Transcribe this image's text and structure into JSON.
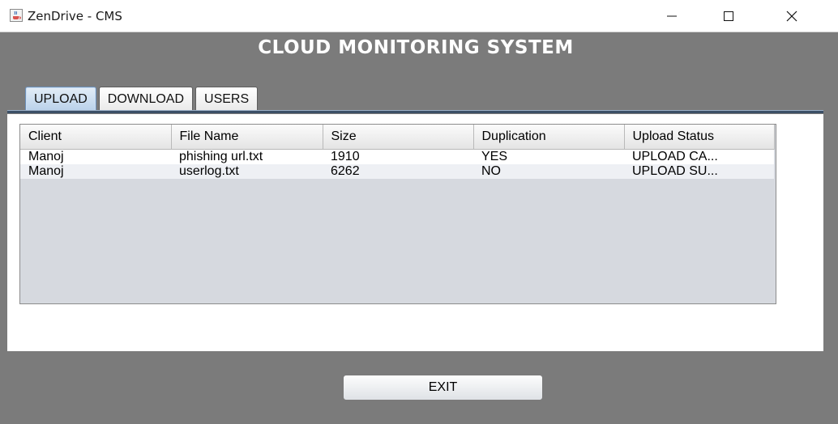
{
  "window": {
    "title": "ZenDrive - CMS",
    "minimize_glyph": "—",
    "maximize_glyph": "☐",
    "close_glyph": "✕"
  },
  "heading": "CLOUD MONITORING SYSTEM",
  "tabs": [
    {
      "label": "UPLOAD",
      "active": true
    },
    {
      "label": "DOWNLOAD",
      "active": false
    },
    {
      "label": "USERS",
      "active": false
    }
  ],
  "table": {
    "columns": [
      "Client",
      "File Name",
      "Size",
      "Duplication",
      "Upload Status"
    ],
    "rows": [
      [
        "Manoj",
        "phishing url.txt",
        "1910",
        "YES",
        "UPLOAD CA..."
      ],
      [
        "Manoj",
        "userlog.txt",
        "6262",
        "NO",
        "UPLOAD SU..."
      ]
    ]
  },
  "exit_label": "EXIT",
  "colors": {
    "background": "#7b7b7b",
    "active_tab": "#b9d1ea",
    "heading_text": "#ffffff"
  },
  "icons": {
    "app": "java-cup-icon",
    "minimize": "minimize-icon",
    "maximize": "maximize-icon",
    "close": "close-icon"
  }
}
